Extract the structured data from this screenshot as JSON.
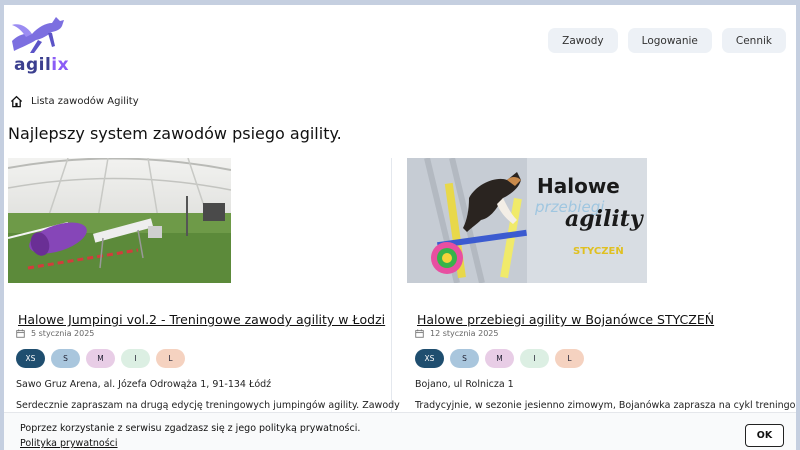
{
  "brand": {
    "name_main": "agil",
    "name_accent": "ix"
  },
  "nav": {
    "items": [
      "Zawody",
      "Logowanie",
      "Cennik"
    ]
  },
  "breadcrumb": {
    "label": "Lista zawodów Agility"
  },
  "page": {
    "title": "Najlepszy system zawodów psiego agility."
  },
  "cards": [
    {
      "title": "Halowe Jumpingi vol.2 - Treningowe zawody agility w Łodzi",
      "date": "5 stycznia 2025",
      "sizes": [
        "XS",
        "S",
        "M",
        "I",
        "L"
      ],
      "address": "Sawo Gruz Arena, al. Józefa Odrowąża 1, 91-134 Łódź",
      "description": "Serdecznie zapraszam na drugą edycję treningowych jumpingów agility. Zawody"
    },
    {
      "title": "Halowe przebiegi agility w Bojanówce STYCZEŃ",
      "date": "12 stycznia 2025",
      "sizes": [
        "XS",
        "S",
        "M",
        "I",
        "L"
      ],
      "address": "Bojano, ul Rolnicza 1",
      "description": "Tradycyjnie, w sezonie jesienno zimowym, Bojanówka zaprasza na cykl treningowych",
      "image_text": {
        "line1": "Halowe",
        "line2": "przebiegi",
        "line3": "agility",
        "line4": "STYCZEŃ"
      }
    }
  ],
  "cookie": {
    "text": "Poprzez korzystanie z serwisu zgadzasz się z jego polityką prywatności.",
    "link": "Polityka prywatności",
    "button": "OK"
  },
  "colors": {
    "xs": "#1f4e6f",
    "s": "#a9c6dd",
    "m": "#e8cde6",
    "i": "#dcefe3",
    "l": "#f5d2c0",
    "brand": "#3b3f8f"
  }
}
